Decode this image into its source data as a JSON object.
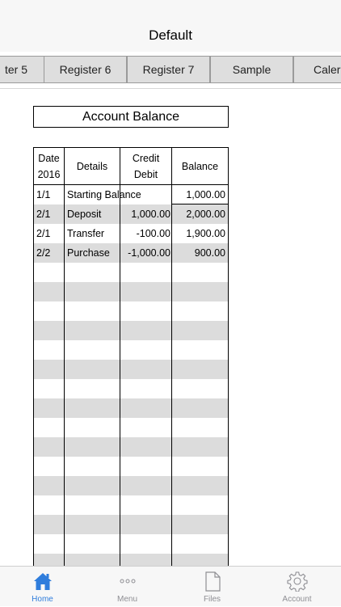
{
  "nav": {
    "title": "Default"
  },
  "tabs": [
    {
      "label": "ter 5"
    },
    {
      "label": "Register 6"
    },
    {
      "label": "Register 7"
    },
    {
      "label": "Sample"
    },
    {
      "label": "Caler"
    }
  ],
  "balance_title": "Account Balance",
  "ledger": {
    "headers": {
      "date_line1": "Date",
      "date_line2": "2016",
      "details": "Details",
      "amount_line1": "Credit",
      "amount_line2": "Debit",
      "balance": "Balance"
    },
    "rows": [
      {
        "date": "1/1",
        "details": "Starting Balance",
        "amount": "",
        "balance": "1,000.00"
      },
      {
        "date": "2/1",
        "details": "Deposit",
        "amount": "1,000.00",
        "balance": "2,000.00"
      },
      {
        "date": "2/1",
        "details": "Transfer",
        "amount": "-100.00",
        "balance": "1,900.00"
      },
      {
        "date": "2/2",
        "details": "Purchase",
        "amount": "-1,000.00",
        "balance": "900.00"
      }
    ]
  },
  "tabbar": {
    "items": [
      {
        "label": "Home",
        "icon": "home-icon",
        "active": true
      },
      {
        "label": "Menu",
        "icon": "more-dots-icon"
      },
      {
        "label": "Files",
        "icon": "file-icon"
      },
      {
        "label": "Account",
        "icon": "gear-icon"
      }
    ]
  },
  "colors": {
    "accent": "#2f7ddc",
    "row_shade": "#dcdcdc",
    "tab_bg": "#dedede"
  }
}
